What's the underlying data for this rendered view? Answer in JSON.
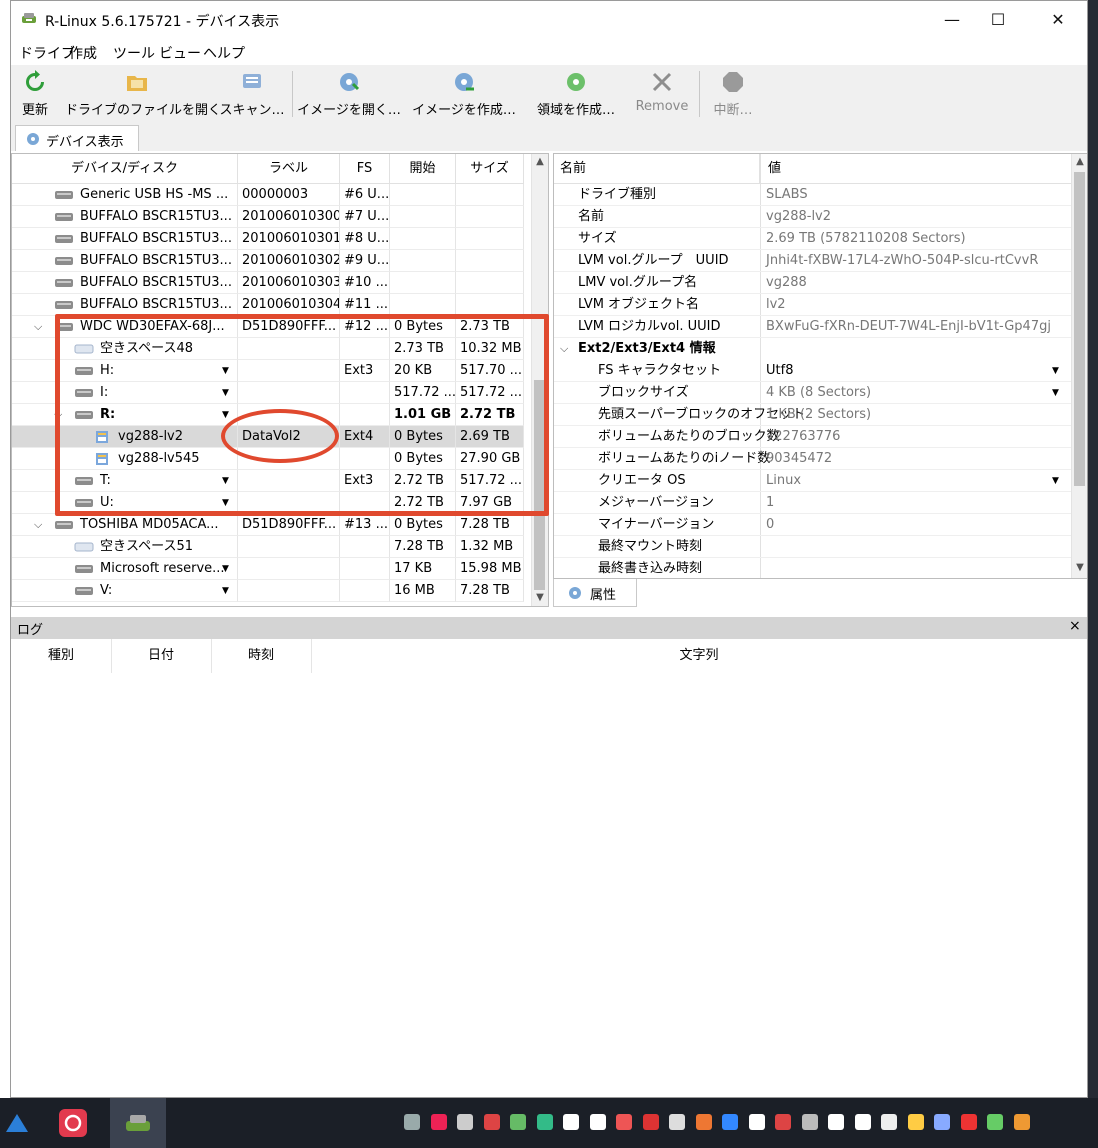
{
  "window": {
    "title": "R-Linux 5.6.175721 - デバイス表示",
    "minimize": "—",
    "maximize": "☐",
    "close": "✕"
  },
  "menu": [
    "ドライブ",
    "作成",
    "ツール",
    "ビュー",
    "ヘルプ"
  ],
  "toolbar": [
    {
      "label": "更新",
      "icon": "refresh-icon",
      "enabled": true
    },
    {
      "label": "ドライブのファイルを開く",
      "icon": "open-drive-files-icon",
      "enabled": true
    },
    {
      "label": "スキャン…",
      "icon": "scan-icon",
      "enabled": true
    },
    {
      "label": "イメージを開く…",
      "icon": "open-image-icon",
      "enabled": true
    },
    {
      "label": "イメージを作成…",
      "icon": "create-image-icon",
      "enabled": true
    },
    {
      "label": "領域を作成…",
      "icon": "create-region-icon",
      "enabled": true
    },
    {
      "label": "Remove",
      "icon": "remove-icon",
      "enabled": false
    },
    {
      "label": "中断…",
      "icon": "stop-icon",
      "enabled": false
    }
  ],
  "tabs": {
    "device_view": "デバイス表示",
    "properties": "属性"
  },
  "device_table": {
    "headers": [
      "デバイス/ディスク",
      "ラベル",
      "FS",
      "開始",
      "サイズ"
    ],
    "rows": [
      {
        "name": "Generic USB HS -MS ...",
        "label": "00000003",
        "fs": "#6 U...",
        "start": "",
        "size": "",
        "indent": 1,
        "icon": "drive",
        "expander": "",
        "dropdown": false
      },
      {
        "name": "BUFFALO BSCR15TU3...",
        "label": "201006010300",
        "fs": "#7 U...",
        "start": "",
        "size": "",
        "indent": 1,
        "icon": "drive",
        "expander": "",
        "dropdown": false
      },
      {
        "name": "BUFFALO BSCR15TU3...",
        "label": "201006010301",
        "fs": "#8 U...",
        "start": "",
        "size": "",
        "indent": 1,
        "icon": "drive",
        "expander": "",
        "dropdown": false
      },
      {
        "name": "BUFFALO BSCR15TU3...",
        "label": "201006010302",
        "fs": "#9 U...",
        "start": "",
        "size": "",
        "indent": 1,
        "icon": "drive",
        "expander": "",
        "dropdown": false
      },
      {
        "name": "BUFFALO BSCR15TU3...",
        "label": "201006010303",
        "fs": "#10 ...",
        "start": "",
        "size": "",
        "indent": 1,
        "icon": "drive",
        "expander": "",
        "dropdown": false
      },
      {
        "name": "BUFFALO BSCR15TU3...",
        "label": "201006010304",
        "fs": "#11 ...",
        "start": "",
        "size": "",
        "indent": 1,
        "icon": "drive",
        "expander": "",
        "dropdown": false
      },
      {
        "name": "WDC WD30EFAX-68J...",
        "label": "D51D890FFF...",
        "fs": "#12 ...",
        "start": "0 Bytes",
        "size": "2.73 TB",
        "indent": 1,
        "icon": "drive",
        "expander": "⌄",
        "dropdown": false
      },
      {
        "name": "空きスペース48",
        "label": "",
        "fs": "",
        "start": "2.73 TB",
        "size": "10.32 MB",
        "indent": 2,
        "icon": "free",
        "expander": "",
        "dropdown": false
      },
      {
        "name": "H:",
        "label": "",
        "fs": "Ext3",
        "start": "20 KB",
        "size": "517.70 ...",
        "indent": 2,
        "icon": "drive",
        "expander": "",
        "dropdown": true
      },
      {
        "name": "I:",
        "label": "",
        "fs": "",
        "start": "517.72 ...",
        "size": "517.72 ...",
        "indent": 2,
        "icon": "drive",
        "expander": "",
        "dropdown": true
      },
      {
        "name": "R:",
        "label": "",
        "fs": "",
        "start": "1.01 GB",
        "size": "2.72 TB",
        "indent": 2,
        "icon": "drive",
        "expander": "⌄",
        "dropdown": true,
        "bold": true
      },
      {
        "name": "vg288-lv2",
        "label": "DataVol2",
        "fs": "Ext4",
        "start": "0 Bytes",
        "size": "2.69 TB",
        "indent": 3,
        "icon": "volume",
        "expander": "",
        "dropdown": false,
        "selected": true
      },
      {
        "name": "vg288-lv545",
        "label": "",
        "fs": "",
        "start": "0 Bytes",
        "size": "27.90 GB",
        "indent": 3,
        "icon": "volume",
        "expander": "",
        "dropdown": false
      },
      {
        "name": "T:",
        "label": "",
        "fs": "Ext3",
        "start": "2.72 TB",
        "size": "517.72 ...",
        "indent": 2,
        "icon": "drive",
        "expander": "",
        "dropdown": true
      },
      {
        "name": "U:",
        "label": "",
        "fs": "",
        "start": "2.72 TB",
        "size": "7.97 GB",
        "indent": 2,
        "icon": "drive",
        "expander": "",
        "dropdown": true
      },
      {
        "name": "TOSHIBA MD05ACA...",
        "label": "D51D890FFF...",
        "fs": "#13 ...",
        "start": "0 Bytes",
        "size": "7.28 TB",
        "indent": 1,
        "icon": "drive",
        "expander": "⌄",
        "dropdown": false
      },
      {
        "name": "空きスペース51",
        "label": "",
        "fs": "",
        "start": "7.28 TB",
        "size": "1.32 MB",
        "indent": 2,
        "icon": "free",
        "expander": "",
        "dropdown": false
      },
      {
        "name": "Microsoft reserve...",
        "label": "",
        "fs": "",
        "start": "17 KB",
        "size": "15.98 MB",
        "indent": 2,
        "icon": "drive",
        "expander": "",
        "dropdown": true
      },
      {
        "name": "V:",
        "label": "",
        "fs": "",
        "start": "16 MB",
        "size": "7.28 TB",
        "indent": 2,
        "icon": "drive",
        "expander": "",
        "dropdown": true
      }
    ]
  },
  "properties": {
    "headers": [
      "名前",
      "値"
    ],
    "rows": [
      {
        "name": "ドライブ種別",
        "value": "SLABS",
        "level": 1
      },
      {
        "name": "名前",
        "value": "vg288-lv2",
        "level": 1
      },
      {
        "name": "サイズ",
        "value": "2.69 TB (5782110208 Sectors)",
        "level": 1
      },
      {
        "name": "LVM vol.グループ　UUID",
        "value": "Jnhi4t-fXBW-17L4-zWhO-504P-slcu-rtCvvR",
        "level": 1
      },
      {
        "name": "LMV vol.グループ名",
        "value": "vg288",
        "level": 1
      },
      {
        "name": "LVM オブジェクト名",
        "value": "lv2",
        "level": 1
      },
      {
        "name": "LVM ロジカルvol. UUID",
        "value": "BXwFuG-fXRn-DEUT-7W4L-EnjI-bV1t-Gp47gj",
        "level": 1
      },
      {
        "name": "Ext2/Ext3/Ext4 情報",
        "value": "",
        "level": 0,
        "section": true
      },
      {
        "name": "FS キャラクタセット",
        "value": "Utf8",
        "level": 2,
        "dropdown": true,
        "dark": true
      },
      {
        "name": "ブロックサイズ",
        "value": "4 KB (8 Sectors)",
        "level": 2,
        "dropdown": true
      },
      {
        "name": "先頭スーパーブロックのオフセット",
        "value": "1 KB (2 Sectors)",
        "level": 2
      },
      {
        "name": "ボリュームあたりのブロック数",
        "value": "722763776",
        "level": 2
      },
      {
        "name": "ボリュームあたりのiノード数",
        "value": "90345472",
        "level": 2
      },
      {
        "name": "クリエータ OS",
        "value": "Linux",
        "level": 2,
        "dropdown": true
      },
      {
        "name": "メジャーバージョン",
        "value": "1",
        "level": 2
      },
      {
        "name": "マイナーバージョン",
        "value": "0",
        "level": 2
      },
      {
        "name": "最終マウント時刻",
        "value": "",
        "level": 2
      },
      {
        "name": "最終書き込み時刻",
        "value": "",
        "level": 2
      }
    ]
  },
  "log": {
    "title": "ログ",
    "close": "×",
    "headers": [
      "種別",
      "日付",
      "時刻",
      "文字列"
    ]
  },
  "colors": {
    "annotation": "#e0492e",
    "selected_row": "#d9d9d9",
    "taskbar": "#1b1f27"
  }
}
